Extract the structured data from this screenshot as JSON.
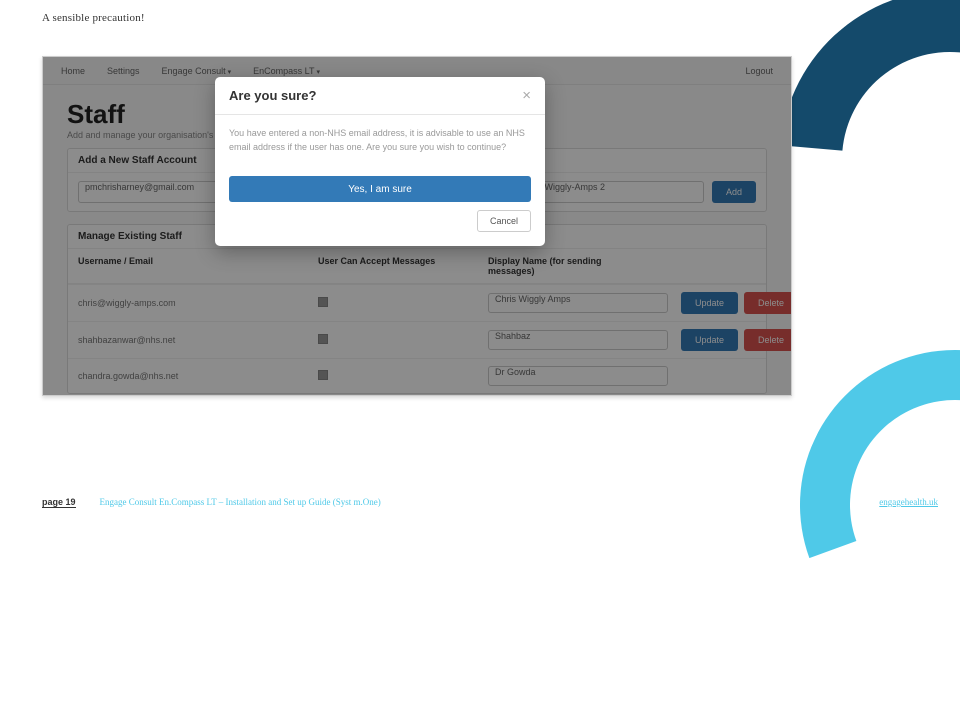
{
  "slide": {
    "title": "A sensible precaution!"
  },
  "nav": {
    "home": "Home",
    "settings": "Settings",
    "engage": "Engage Consult",
    "encompass": "EnCompass LT",
    "logout": "Logout"
  },
  "staff": {
    "heading": "Staff",
    "sub": "Add and manage your organisation's staff to",
    "add_panel": "Add a New Staff Account",
    "email_value": "pmchrisharney@gmail.com",
    "display_value": "Chris Wiggly-Amps 2",
    "add_btn": "Add",
    "manage_panel": "Manage Existing Staff",
    "cols": {
      "a": "Username / Email",
      "b": "User Can Accept Messages",
      "c": "Display Name (for sending messages)"
    },
    "rows": [
      {
        "email": "chris@wiggly-amps.com",
        "display": "Chris Wiggly Amps"
      },
      {
        "email": "shahbazanwar@nhs.net",
        "display": "Shahbaz"
      },
      {
        "email": "chandra.gowda@nhs.net",
        "display": "Dr Gowda"
      }
    ],
    "update": "Update",
    "delete": "Delete"
  },
  "modal": {
    "title": "Are you sure?",
    "body": "You have entered a non-NHS email address, it is advisable to use an NHS email address if the user has one. Are you sure you wish to continue?",
    "yes": "Yes, I am sure",
    "cancel": "Cancel"
  },
  "footer": {
    "page_label": "page",
    "page_num": "19",
    "doc": "Engage Consult En.Compass LT – Installation and Set up Guide (Syst m.One)",
    "site": "engagehealth.uk"
  }
}
